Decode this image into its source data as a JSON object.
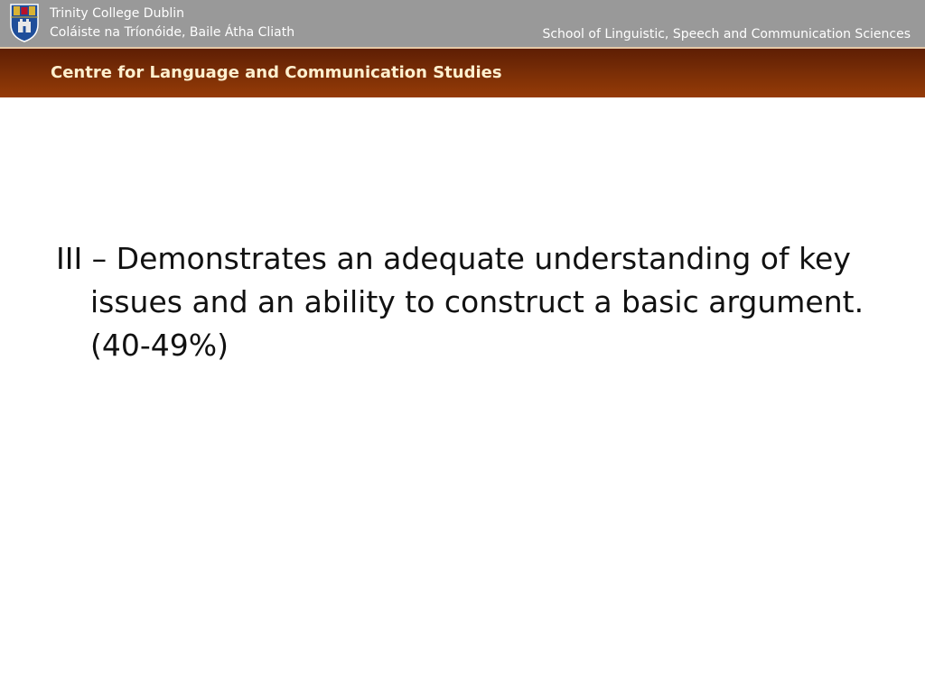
{
  "header": {
    "college_name": "Trinity College Dublin",
    "college_name_irish": "Coláiste na Tríonóide, Baile Átha Cliath",
    "school": "School of Linguistic, Speech and Communication Sciences",
    "centre": "Centre for Language and Communication Studies",
    "crest_icon": "college-crest-icon"
  },
  "slide": {
    "bullet": "III – Demonstrates an adequate understanding of key issues and an ability to construct a basic argument. (40-49%)"
  },
  "colors": {
    "header_grey": "#999999",
    "banner_brown": "#7a2e06",
    "banner_text": "#fff0cf"
  }
}
